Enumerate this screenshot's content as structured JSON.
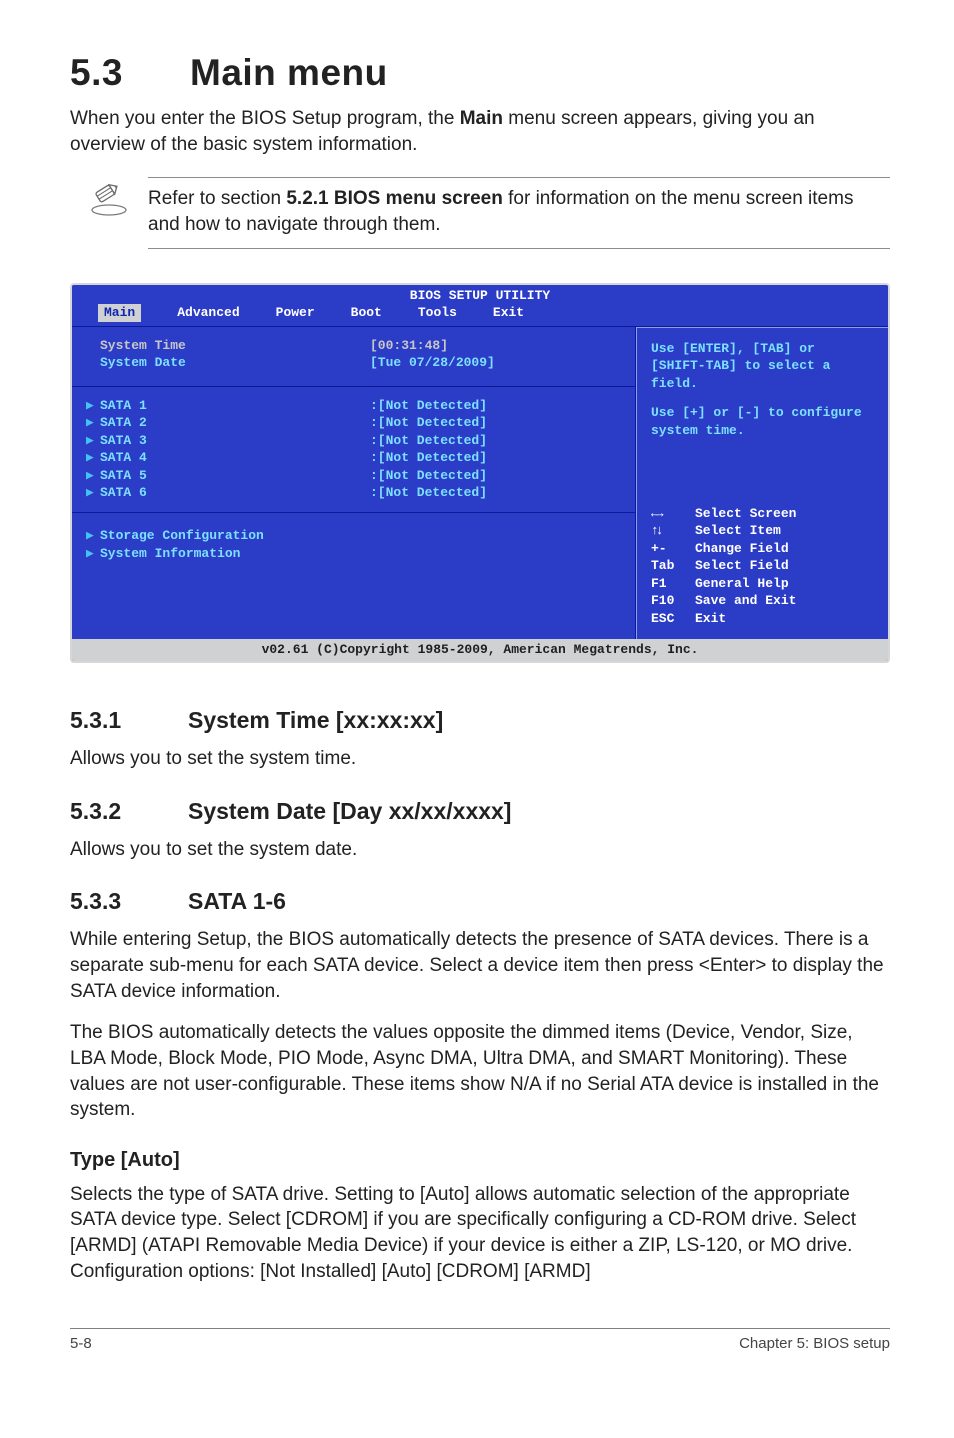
{
  "heading": {
    "number": "5.3",
    "title": "Main menu"
  },
  "intro": "When you enter the BIOS Setup program, the <b>Main</b> menu screen appears, giving you an overview of the basic system information.",
  "note": "Refer to section <b>5.2.1 BIOS menu screen</b> for information on the menu screen items and how to navigate through them.",
  "bios": {
    "title": "BIOS SETUP UTILITY",
    "menu": [
      "Main",
      "Advanced",
      "Power",
      "Boot",
      "Tools",
      "Exit"
    ],
    "time_label": "System Time",
    "time_value": "[00:31:48]",
    "date_label": "System Date",
    "date_value": "[Tue 07/28/2009]",
    "sata": [
      {
        "label": "SATA 1",
        "value": ":[Not Detected]"
      },
      {
        "label": "SATA 2",
        "value": ":[Not Detected]"
      },
      {
        "label": "SATA 3",
        "value": ":[Not Detected]"
      },
      {
        "label": "SATA 4",
        "value": ":[Not Detected]"
      },
      {
        "label": "SATA 5",
        "value": ":[Not Detected]"
      },
      {
        "label": "SATA 6",
        "value": ":[Not Detected]"
      }
    ],
    "storage": "Storage Configuration",
    "sysinfo": "System Information",
    "help1": "Use [ENTER], [TAB] or [SHIFT-TAB] to select a field.",
    "help2": "Use [+] or [-] to configure system time.",
    "keys": [
      {
        "k": "←→",
        "t": "Select Screen"
      },
      {
        "k": "↑↓",
        "t": "Select Item"
      },
      {
        "k": "+-",
        "t": "Change Field"
      },
      {
        "k": "Tab",
        "t": "Select Field"
      },
      {
        "k": "F1",
        "t": "General Help"
      },
      {
        "k": "F10",
        "t": "Save and Exit"
      },
      {
        "k": "ESC",
        "t": "Exit"
      }
    ],
    "footer": "v02.61 (C)Copyright 1985-2009, American Megatrends, Inc."
  },
  "sec531": {
    "num": "5.3.1",
    "title": "System Time [xx:xx:xx]",
    "body": "Allows you to set the system time."
  },
  "sec532": {
    "num": "5.3.2",
    "title": "System Date [Day xx/xx/xxxx]",
    "body": "Allows you to set the system date."
  },
  "sec533": {
    "num": "5.3.3",
    "title": "SATA 1-6",
    "p1": "While entering Setup, the BIOS automatically detects the presence of SATA devices. There is a separate sub-menu for each SATA device. Select a device item then press <Enter> to display the SATA device information.",
    "p2": "The BIOS automatically detects the values opposite the dimmed items (Device, Vendor, Size, LBA Mode, Block Mode, PIO Mode, Async DMA, Ultra DMA, and SMART Monitoring). These values are not user-configurable. These items show N/A if no Serial ATA device is installed in the system."
  },
  "type": {
    "head": "Type [Auto]",
    "body": "Selects the type of SATA drive. Setting to [Auto] allows automatic selection of the appropriate SATA device type. Select [CDROM] if you are specifically configuring a CD-ROM drive. Select [ARMD] (ATAPI Removable Media Device) if your device is either a ZIP, LS-120, or MO drive. Configuration options: [Not Installed] [Auto] [CDROM] [ARMD]"
  },
  "footer": {
    "left": "5-8",
    "right": "Chapter 5: BIOS setup"
  }
}
